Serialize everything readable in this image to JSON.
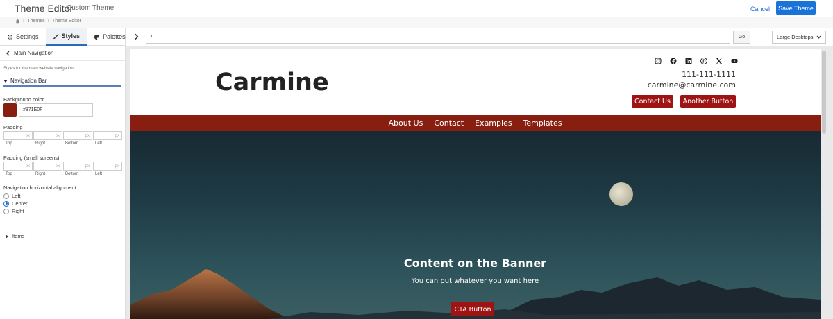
{
  "header": {
    "title": "Theme Editor",
    "subtitle": "Custom Theme",
    "cancel_label": "Cancel",
    "save_label": "Save Theme"
  },
  "breadcrumbs": [
    "Themes",
    "Theme Editor"
  ],
  "tabs": [
    {
      "label": "Settings",
      "icon": "gear-icon"
    },
    {
      "label": "Styles",
      "icon": "brush-icon"
    },
    {
      "label": "Palettes",
      "icon": "palette-icon"
    }
  ],
  "panel": {
    "back_label": "Main Navigation",
    "description": "Styles for the main website navigation.",
    "section": "Navigation Bar",
    "bg_label": "Background color",
    "bg_value": "#871E0F",
    "padding_label": "Padding",
    "padding_small_label": "Padding (small screens)",
    "unit": "px",
    "sides": [
      "Top",
      "Right",
      "Bottom",
      "Left"
    ],
    "align_label": "Navigation horizontal alignment",
    "align_options": [
      "Left",
      "Center",
      "Right"
    ],
    "align_selected": "Center",
    "items_label": "Items"
  },
  "toolbar": {
    "url": "/",
    "go_label": "Go",
    "device": "Large Desktops"
  },
  "site": {
    "logo": "Carmine",
    "phone": "111-111-1111",
    "email": "carmine@carmine.com",
    "contact_btn": "Contact Us",
    "another_btn": "Another Button",
    "nav": [
      "About Us",
      "Contact",
      "Examples",
      "Templates"
    ],
    "banner_title": "Content on the Banner",
    "banner_sub": "You can put whatever you want here",
    "cta": "CTA Button",
    "social": [
      "instagram-icon",
      "facebook-icon",
      "linkedin-icon",
      "pinterest-icon",
      "x-icon",
      "youtube-icon"
    ]
  },
  "colors": {
    "accent": "#1a73d9",
    "nav_bg": "#871E0F",
    "button": "#9e1313"
  }
}
